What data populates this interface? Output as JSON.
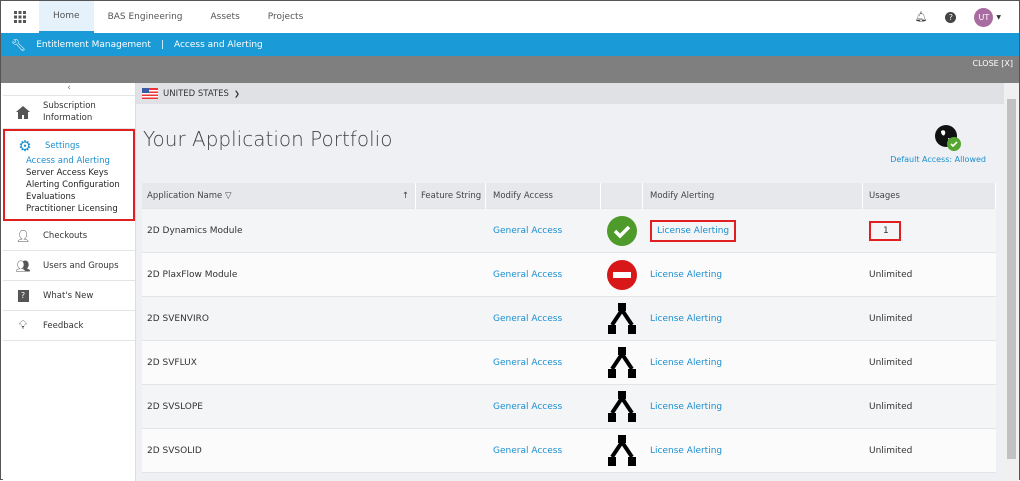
{
  "topnav": {
    "tabs": [
      "Home",
      "BAS Engineering",
      "Assets",
      "Projects"
    ],
    "avatar": "UT"
  },
  "breadcrumb": {
    "section": "Entitlement Management",
    "separator": "|",
    "page": "Access and Alerting"
  },
  "close_label": "CLOSE [X]",
  "sidebar": {
    "collapse": "‹",
    "subscription": "Subscription Information",
    "settings": "Settings",
    "settings_sub": [
      "Access and Alerting",
      "Server Access Keys",
      "Alerting Configuration",
      "Evaluations",
      "Practitioner Licensing"
    ],
    "checkouts": "Checkouts",
    "users": "Users and Groups",
    "whatsnew": "What's New",
    "feedback": "Feedback"
  },
  "country": "UNITED STATES",
  "title": "Your Application Portfolio",
  "default_access": "Default Access: Allowed",
  "table": {
    "headers": [
      "Application Name",
      "Feature String",
      "Modify Access",
      "",
      "Modify Alerting",
      "Usages"
    ],
    "rows": [
      {
        "name": "2D Dynamics Module",
        "access": "General Access",
        "status": "allowed",
        "alerting": "License Alerting",
        "usages": "1"
      },
      {
        "name": "2D PlaxFlow Module",
        "access": "General Access",
        "status": "denied",
        "alerting": "License Alerting",
        "usages": "Unlimited"
      },
      {
        "name": "2D SVENVIRO",
        "access": "General Access",
        "status": "inherited",
        "alerting": "License Alerting",
        "usages": "Unlimited"
      },
      {
        "name": "2D SVFLUX",
        "access": "General Access",
        "status": "inherited",
        "alerting": "License Alerting",
        "usages": "Unlimited"
      },
      {
        "name": "2D SVSLOPE",
        "access": "General Access",
        "status": "inherited",
        "alerting": "License Alerting",
        "usages": "Unlimited"
      },
      {
        "name": "2D SVSOLID",
        "access": "General Access",
        "status": "inherited",
        "alerting": "License Alerting",
        "usages": "Unlimited"
      }
    ]
  }
}
